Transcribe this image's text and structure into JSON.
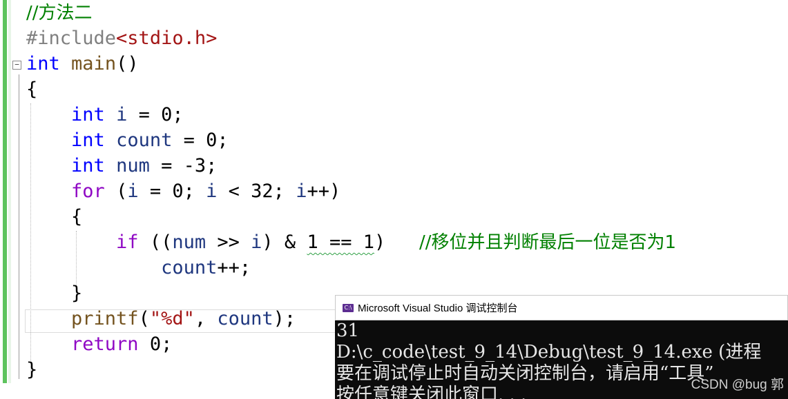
{
  "editor": {
    "lines": [
      {
        "tokens": [
          {
            "t": "//方法二",
            "c": "cm"
          }
        ]
      },
      {
        "tokens": [
          {
            "t": "#include",
            "c": "pp"
          },
          {
            "t": "<stdio.h>",
            "c": "inc"
          }
        ]
      },
      {
        "tokens": [
          {
            "t": "int",
            "c": "kw"
          },
          {
            "t": " ",
            "c": "plain"
          },
          {
            "t": "main",
            "c": "fn"
          },
          {
            "t": "()",
            "c": "plain"
          }
        ]
      },
      {
        "tokens": [
          {
            "t": "{",
            "c": "plain"
          }
        ]
      },
      {
        "tokens": [
          {
            "t": "    ",
            "c": "plain"
          },
          {
            "t": "int",
            "c": "kw"
          },
          {
            "t": " ",
            "c": "plain"
          },
          {
            "t": "i",
            "c": "var"
          },
          {
            "t": " = 0;",
            "c": "plain"
          }
        ]
      },
      {
        "tokens": [
          {
            "t": "    ",
            "c": "plain"
          },
          {
            "t": "int",
            "c": "kw"
          },
          {
            "t": " ",
            "c": "plain"
          },
          {
            "t": "count",
            "c": "var"
          },
          {
            "t": " = 0;",
            "c": "plain"
          }
        ]
      },
      {
        "tokens": [
          {
            "t": "    ",
            "c": "plain"
          },
          {
            "t": "int",
            "c": "kw"
          },
          {
            "t": " ",
            "c": "plain"
          },
          {
            "t": "num",
            "c": "var"
          },
          {
            "t": " = -3;",
            "c": "plain"
          }
        ]
      },
      {
        "tokens": [
          {
            "t": "    ",
            "c": "plain"
          },
          {
            "t": "for",
            "c": "ctl"
          },
          {
            "t": " (",
            "c": "plain"
          },
          {
            "t": "i",
            "c": "var"
          },
          {
            "t": " = 0; ",
            "c": "plain"
          },
          {
            "t": "i",
            "c": "var"
          },
          {
            "t": " < 32; ",
            "c": "plain"
          },
          {
            "t": "i",
            "c": "var"
          },
          {
            "t": "++)",
            "c": "plain"
          }
        ]
      },
      {
        "tokens": [
          {
            "t": "    {",
            "c": "plain"
          }
        ]
      },
      {
        "tokens": [
          {
            "t": "        ",
            "c": "plain"
          },
          {
            "t": "if",
            "c": "ctl"
          },
          {
            "t": " ((",
            "c": "plain"
          },
          {
            "t": "num",
            "c": "var"
          },
          {
            "t": " >> ",
            "c": "plain"
          },
          {
            "t": "i",
            "c": "var"
          },
          {
            "t": ") & ",
            "c": "plain"
          },
          {
            "t": "1 == 1",
            "c": "squig"
          },
          {
            "t": ")   ",
            "c": "plain"
          },
          {
            "t": "//移位并且判断最后一位是否为1",
            "c": "cm"
          }
        ]
      },
      {
        "tokens": [
          {
            "t": "            ",
            "c": "plain"
          },
          {
            "t": "count",
            "c": "var"
          },
          {
            "t": "++;",
            "c": "plain"
          }
        ]
      },
      {
        "tokens": [
          {
            "t": "    }",
            "c": "plain"
          }
        ]
      },
      {
        "tokens": [
          {
            "t": "    ",
            "c": "plain"
          },
          {
            "t": "printf",
            "c": "fn"
          },
          {
            "t": "(",
            "c": "plain"
          },
          {
            "t": "\"%d\"",
            "c": "str"
          },
          {
            "t": ", ",
            "c": "plain"
          },
          {
            "t": "count",
            "c": "var"
          },
          {
            "t": ");",
            "c": "plain"
          }
        ]
      },
      {
        "tokens": [
          {
            "t": "    ",
            "c": "plain"
          },
          {
            "t": "return",
            "c": "ctl"
          },
          {
            "t": " 0;",
            "c": "plain"
          }
        ]
      },
      {
        "tokens": [
          {
            "t": "}",
            "c": "plain"
          }
        ]
      }
    ]
  },
  "console": {
    "title": "Microsoft Visual Studio 调试控制台",
    "icon": "vs-console-icon",
    "output": [
      "31",
      "D:\\c_code\\test_9_14\\Debug\\test_9_14.exe (进程",
      "要在调试停止时自动关闭控制台，请启用“工具”",
      "按任意键关闭此窗口. . ."
    ]
  },
  "watermark": "CSDN @bug 郭"
}
